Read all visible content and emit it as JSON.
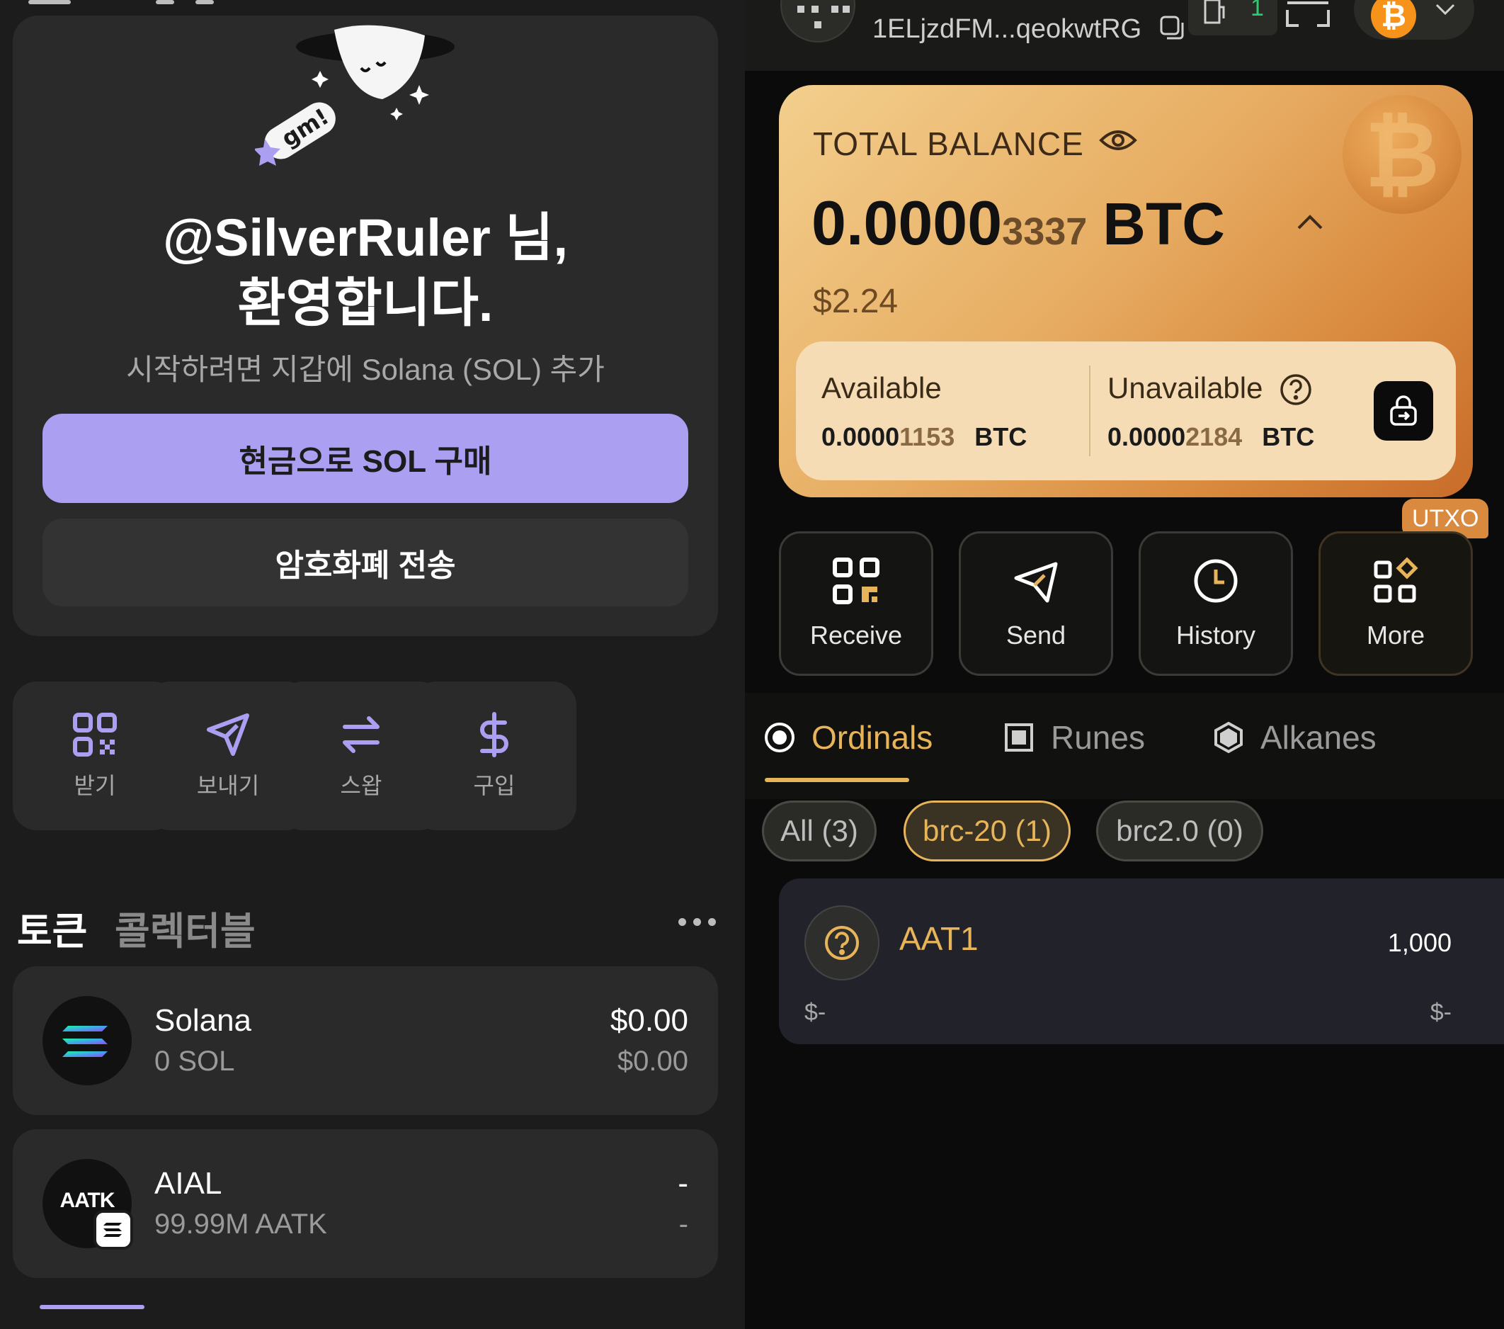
{
  "left": {
    "welcome": {
      "title_line1": "@SilverRuler 님,",
      "title_line2": "환영합니다.",
      "subtitle": "시작하려면 지갑에 Solana (SOL) 추가",
      "mascot_badge": "gm!",
      "buy_button": "현금으로 SOL 구매",
      "send_button": "암호화폐 전송"
    },
    "actions": [
      {
        "label": "받기",
        "icon": "qr-icon"
      },
      {
        "label": "보내기",
        "icon": "send-icon"
      },
      {
        "label": "스왑",
        "icon": "swap-icon"
      },
      {
        "label": "구입",
        "icon": "dollar-icon"
      }
    ],
    "tabs": {
      "active": "토큰",
      "inactive": "콜렉터블"
    },
    "tokens": [
      {
        "name": "Solana",
        "amount": "0 SOL",
        "value": "$0.00",
        "value_sub": "$0.00",
        "logo": "solana-logo"
      },
      {
        "name": "AIAL",
        "amount": "99.99M AATK",
        "value": "-",
        "value_sub": "-",
        "logo_text": "AATK"
      }
    ],
    "accent": "#ab9ff2"
  },
  "right": {
    "header": {
      "address": "1ELjzdFM...qeokwtRG",
      "gas_indicator": "1",
      "chain_symbol": "₿"
    },
    "card": {
      "total_label": "TOTAL BALANCE",
      "balance_main": "0.0000",
      "balance_dim": "3337",
      "balance_unit": "BTC",
      "usd": "$2.24",
      "available_label": "Available",
      "available_main": "0.0000",
      "available_dim": "1153",
      "available_unit": "BTC",
      "unavailable_label": "Unavailable",
      "unavailable_main": "0.0000",
      "unavailable_dim": "2184",
      "unavailable_unit": "BTC",
      "coin_symbol": "₿"
    },
    "utxo_badge": "UTXO",
    "actions": [
      {
        "label": "Receive",
        "icon": "qr-icon"
      },
      {
        "label": "Send",
        "icon": "send-icon"
      },
      {
        "label": "History",
        "icon": "clock-icon"
      },
      {
        "label": "More",
        "icon": "grid-icon"
      }
    ],
    "tabs": [
      {
        "label": "Ordinals",
        "active": true
      },
      {
        "label": "Runes",
        "active": false
      },
      {
        "label": "Alkanes",
        "active": false
      }
    ],
    "chips": [
      {
        "label": "All (3)",
        "active": false
      },
      {
        "label": "brc-20 (1)",
        "active": true
      },
      {
        "label": "brc2.0 (0)",
        "active": false
      }
    ],
    "assets": [
      {
        "name": "AAT1",
        "amount": "1,000",
        "usd": "$-",
        "usd_right": "$-"
      }
    ],
    "accent": "#e8b45a"
  }
}
